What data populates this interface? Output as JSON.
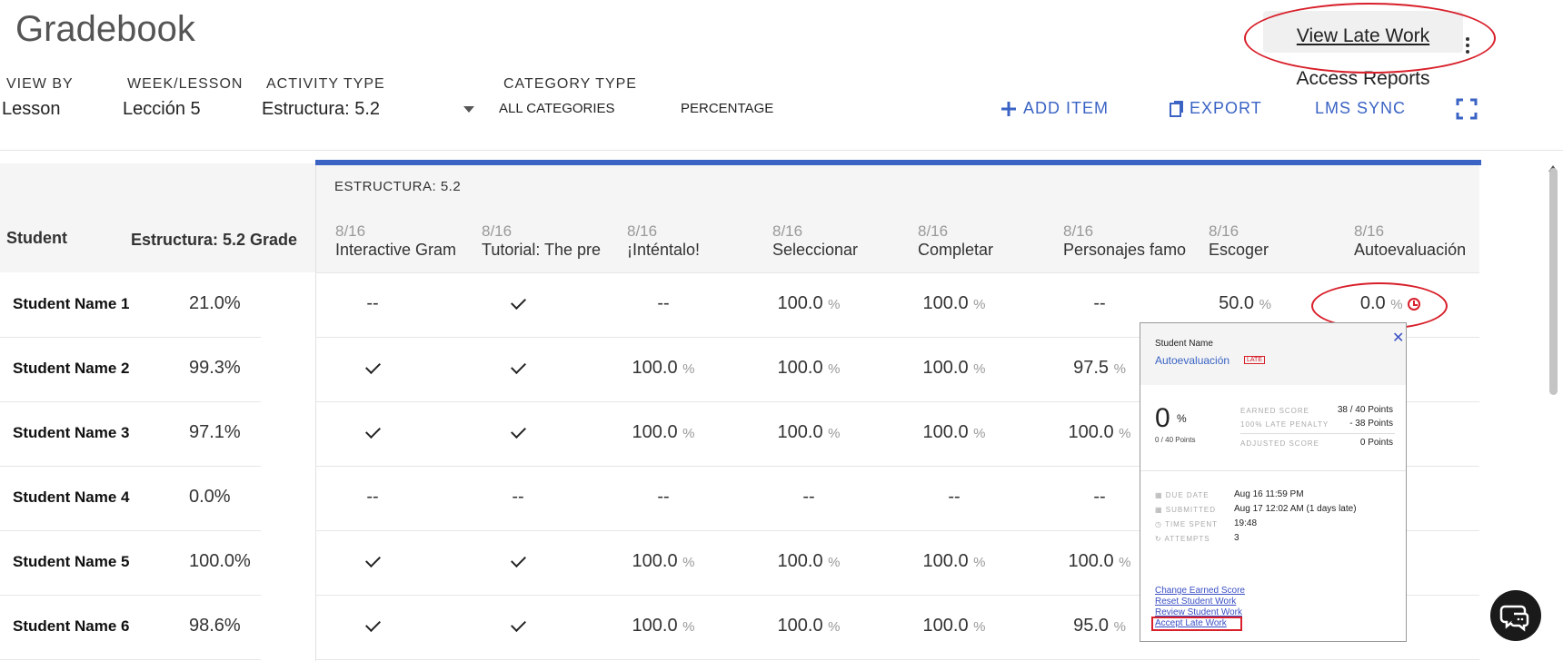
{
  "page": {
    "title": "Gradebook"
  },
  "filters": {
    "view_by": {
      "label": "VIEW BY",
      "value": "Lesson"
    },
    "week_lesson": {
      "label": "WEEK/LESSON",
      "value": "Lección 5"
    },
    "activity_type": {
      "label": "ACTIVITY TYPE",
      "value": "Estructura: 5.2"
    },
    "category_type": {
      "label": "CATEGORY TYPE",
      "value": "ALL CATEGORIES"
    },
    "display": {
      "value": "PERCENTAGE"
    }
  },
  "actions": {
    "add_item": "ADD ITEM",
    "export": "EXPORT",
    "lms_sync": "LMS SYNC"
  },
  "menu": {
    "view_late_work": "View Late Work",
    "access_reports": "Access Reports"
  },
  "table": {
    "student_header": "Student",
    "grade_header": "Estructura: 5.2 Grade",
    "group_header": "ESTRUCTURA: 5.2",
    "pct_sign": "%",
    "columns": [
      {
        "date": "8/16",
        "name": "Interactive Gram"
      },
      {
        "date": "8/16",
        "name": "Tutorial: The pre"
      },
      {
        "date": "8/16",
        "name": "¡Inténtalo!"
      },
      {
        "date": "8/16",
        "name": "Seleccionar"
      },
      {
        "date": "8/16",
        "name": "Completar"
      },
      {
        "date": "8/16",
        "name": "Personajes famo"
      },
      {
        "date": "8/16",
        "name": "Escoger"
      },
      {
        "date": "8/16",
        "name": "Autoevaluación"
      }
    ],
    "rows": [
      {
        "name": "Student Name 1",
        "grade": "21.0%",
        "cells": [
          "--",
          "check",
          "--",
          "100.0",
          "100.0",
          "--",
          "50.0",
          "0.0"
        ]
      },
      {
        "name": "Student Name 2",
        "grade": "99.3%",
        "cells": [
          "check",
          "check",
          "100.0",
          "100.0",
          "100.0",
          "97.5",
          "",
          ""
        ]
      },
      {
        "name": "Student Name 3",
        "grade": "97.1%",
        "cells": [
          "check",
          "check",
          "100.0",
          "100.0",
          "100.0",
          "100.0",
          "",
          ""
        ]
      },
      {
        "name": "Student Name 4",
        "grade": "0.0%",
        "cells": [
          "--",
          "--",
          "--",
          "--",
          "--",
          "--",
          "",
          ""
        ]
      },
      {
        "name": "Student Name 5",
        "grade": "100.0%",
        "cells": [
          "check",
          "check",
          "100.0",
          "100.0",
          "100.0",
          "100.0",
          "",
          ""
        ]
      },
      {
        "name": "Student Name 6",
        "grade": "98.6%",
        "cells": [
          "check",
          "check",
          "100.0",
          "100.0",
          "100.0",
          "95.0",
          "",
          ""
        ]
      }
    ]
  },
  "popup": {
    "student": "Student Name",
    "activity": "Autoevaluación",
    "late_badge": "LATE",
    "score_big": "0",
    "score_pct": "%",
    "score_sub": "0 / 40 Points",
    "earned_label": "EARNED SCORE",
    "earned_value": "38 / 40 Points",
    "penalty_label": "100% LATE PENALTY",
    "penalty_value": "- 38 Points",
    "adjusted_label": "ADJUSTED SCORE",
    "adjusted_value": "0 Points",
    "due_label": "DUE DATE",
    "due_value": "Aug 16 11:59 PM",
    "submitted_label": "SUBMITTED",
    "submitted_value": "Aug 17 12:02 AM (1 days late)",
    "time_label": "TIME SPENT",
    "time_value": "19:48",
    "attempts_label": "ATTEMPTS",
    "attempts_value": "3",
    "links": [
      "Change Earned Score",
      "Reset Student Work",
      "Review Student Work",
      "Accept Late Work"
    ]
  },
  "colors": {
    "accent": "#3a63c4",
    "highlight": "#d81f2a",
    "muted": "#999999"
  }
}
